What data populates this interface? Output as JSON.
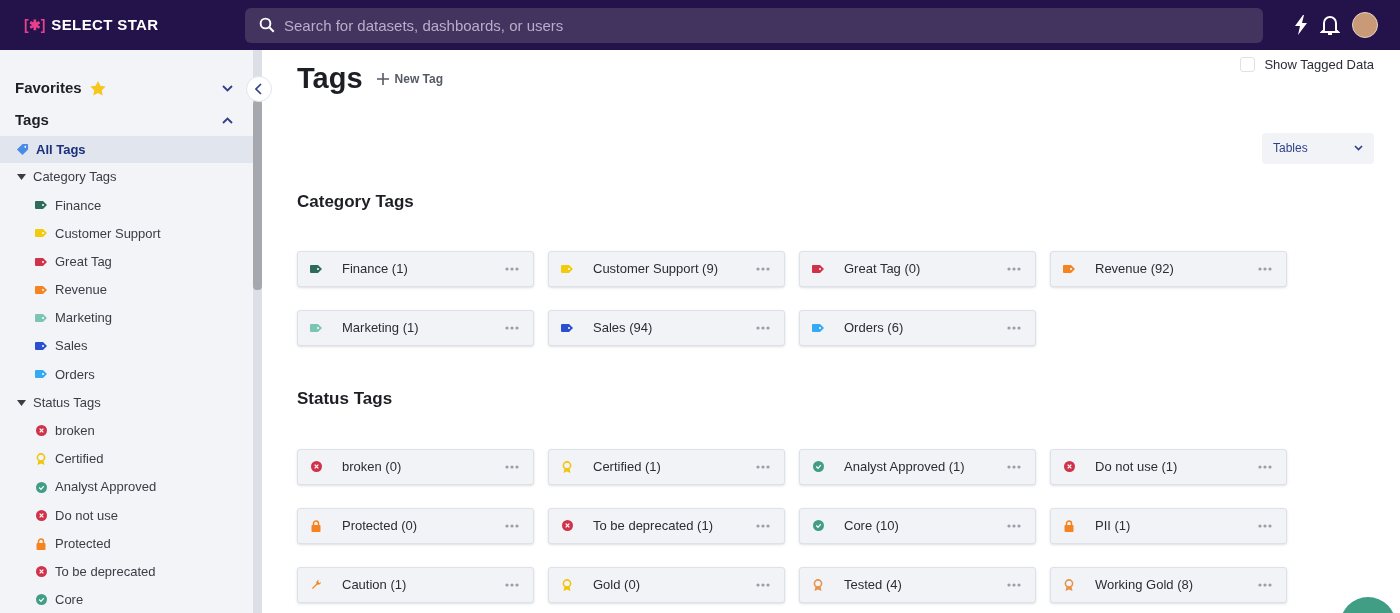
{
  "header": {
    "logo_mark": "[✱]",
    "logo_text": "SELECT STAR",
    "search": {
      "placeholder": "Search for datasets, dashboards, or users"
    }
  },
  "sidebar": {
    "sections": [
      {
        "label": "Favorites",
        "expanded": false
      },
      {
        "label": "Tags",
        "expanded": true
      }
    ],
    "all_tags": {
      "label": "All Tags",
      "selected": true
    },
    "groups": [
      {
        "label": "Category Tags",
        "expanded": true,
        "children": [
          {
            "label": "Finance",
            "kind": "tag",
            "color": "#2f6b5a"
          },
          {
            "label": "Customer Support",
            "kind": "tag",
            "color": "#f2cc0c"
          },
          {
            "label": "Great Tag",
            "kind": "tag",
            "color": "#d0324a"
          },
          {
            "label": "Revenue",
            "kind": "tag",
            "color": "#f5831f"
          },
          {
            "label": "Marketing",
            "kind": "tag",
            "color": "#7cc4b4"
          },
          {
            "label": "Sales",
            "kind": "tag",
            "color": "#2a4fd1"
          },
          {
            "label": "Orders",
            "kind": "tag",
            "color": "#33aaf2"
          }
        ]
      },
      {
        "label": "Status Tags",
        "expanded": true,
        "children": [
          {
            "label": "broken",
            "kind": "x-circle",
            "color": "#d0324a"
          },
          {
            "label": "Certified",
            "kind": "award",
            "color": "#f2c40c"
          },
          {
            "label": "Analyst Approved",
            "kind": "check-circle",
            "color": "#3f9e84"
          },
          {
            "label": "Do not use",
            "kind": "x-circle",
            "color": "#d0324a"
          },
          {
            "label": "Protected",
            "kind": "lock",
            "color": "#f5831f"
          },
          {
            "label": "To be deprecated",
            "kind": "x-circle",
            "color": "#d0324a"
          },
          {
            "label": "Core",
            "kind": "check-circle",
            "color": "#3f9e84"
          }
        ]
      }
    ]
  },
  "main": {
    "title": "Tags",
    "new_tag": "New Tag",
    "show_tagged": {
      "label": "Show Tagged Data",
      "checked": false
    },
    "filter": {
      "value": "Tables"
    },
    "sections": [
      {
        "title": "Category Tags",
        "tags": [
          {
            "label": "Finance (1)",
            "kind": "tag",
            "color": "#2f6b5a"
          },
          {
            "label": "Customer Support (9)",
            "kind": "tag",
            "color": "#f2cc0c"
          },
          {
            "label": "Great Tag (0)",
            "kind": "tag",
            "color": "#d0324a"
          },
          {
            "label": "Revenue (92)",
            "kind": "tag",
            "color": "#f5831f"
          },
          {
            "label": "Marketing (1)",
            "kind": "tag",
            "color": "#7cc4b4"
          },
          {
            "label": "Sales (94)",
            "kind": "tag",
            "color": "#2a4fd1"
          },
          {
            "label": "Orders (6)",
            "kind": "tag",
            "color": "#33aaf2"
          }
        ]
      },
      {
        "title": "Status Tags",
        "tags": [
          {
            "label": "broken (0)",
            "kind": "x-circle",
            "color": "#d0324a"
          },
          {
            "label": "Certified (1)",
            "kind": "award",
            "color": "#f2c40c"
          },
          {
            "label": "Analyst Approved (1)",
            "kind": "check-circle",
            "color": "#3f9e84"
          },
          {
            "label": "Do not use (1)",
            "kind": "x-circle",
            "color": "#d0324a"
          },
          {
            "label": "Protected (0)",
            "kind": "lock",
            "color": "#f5831f"
          },
          {
            "label": "To be deprecated (1)",
            "kind": "x-circle",
            "color": "#d0324a"
          },
          {
            "label": "Core (10)",
            "kind": "check-circle",
            "color": "#3f9e84"
          },
          {
            "label": "PII (1)",
            "kind": "lock",
            "color": "#f5831f"
          },
          {
            "label": "Caution (1)",
            "kind": "wrench",
            "color": "#f5831f"
          },
          {
            "label": "Gold (0)",
            "kind": "award",
            "color": "#f2c40c"
          },
          {
            "label": "Tested (4)",
            "kind": "award",
            "color": "#e8934a"
          },
          {
            "label": "Working Gold (8)",
            "kind": "award",
            "color": "#e8934a"
          }
        ]
      }
    ]
  }
}
